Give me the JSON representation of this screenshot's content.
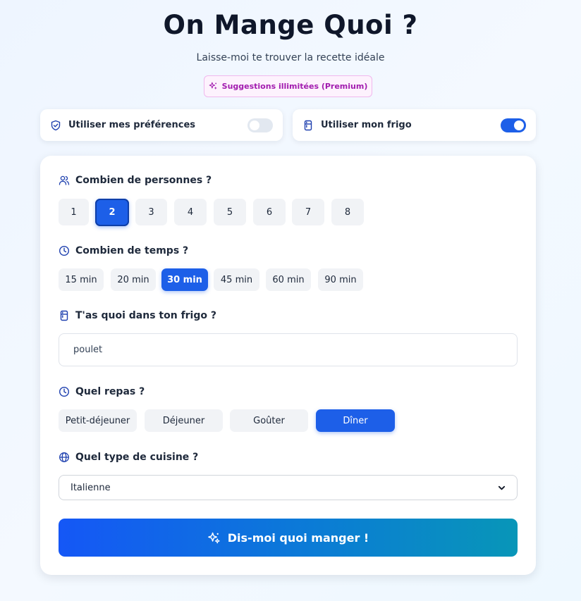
{
  "header": {
    "title": "On Mange Quoi ?",
    "subtitle": "Laisse-moi te trouver la recette idéale",
    "premium_label": "Suggestions illimitées (Premium)"
  },
  "toggles": {
    "preferences": {
      "label": "Utiliser mes préférences",
      "on": false
    },
    "fridge": {
      "label": "Utiliser mon frigo",
      "on": true
    }
  },
  "persons": {
    "label": "Combien de personnes ?",
    "options": [
      "1",
      "2",
      "3",
      "4",
      "5",
      "6",
      "7",
      "8"
    ],
    "selected": "2"
  },
  "time": {
    "label": "Combien de temps ?",
    "options": [
      "15 min",
      "20 min",
      "30 min",
      "45 min",
      "60 min",
      "90 min"
    ],
    "selected": "30 min"
  },
  "fridge": {
    "label": "T'as quoi dans ton frigo ?",
    "value": "poulet"
  },
  "meal": {
    "label": "Quel repas ?",
    "options": [
      "Petit-déjeuner",
      "Déjeuner",
      "Goûter",
      "Dîner"
    ],
    "selected": "Dîner"
  },
  "cuisine": {
    "label": "Quel type de cuisine ?",
    "selected": "Italienne"
  },
  "cta": {
    "label": "Dis-moi quoi manger !"
  },
  "colors": {
    "accent": "#1d5fe8",
    "premium": "#a21caf"
  }
}
